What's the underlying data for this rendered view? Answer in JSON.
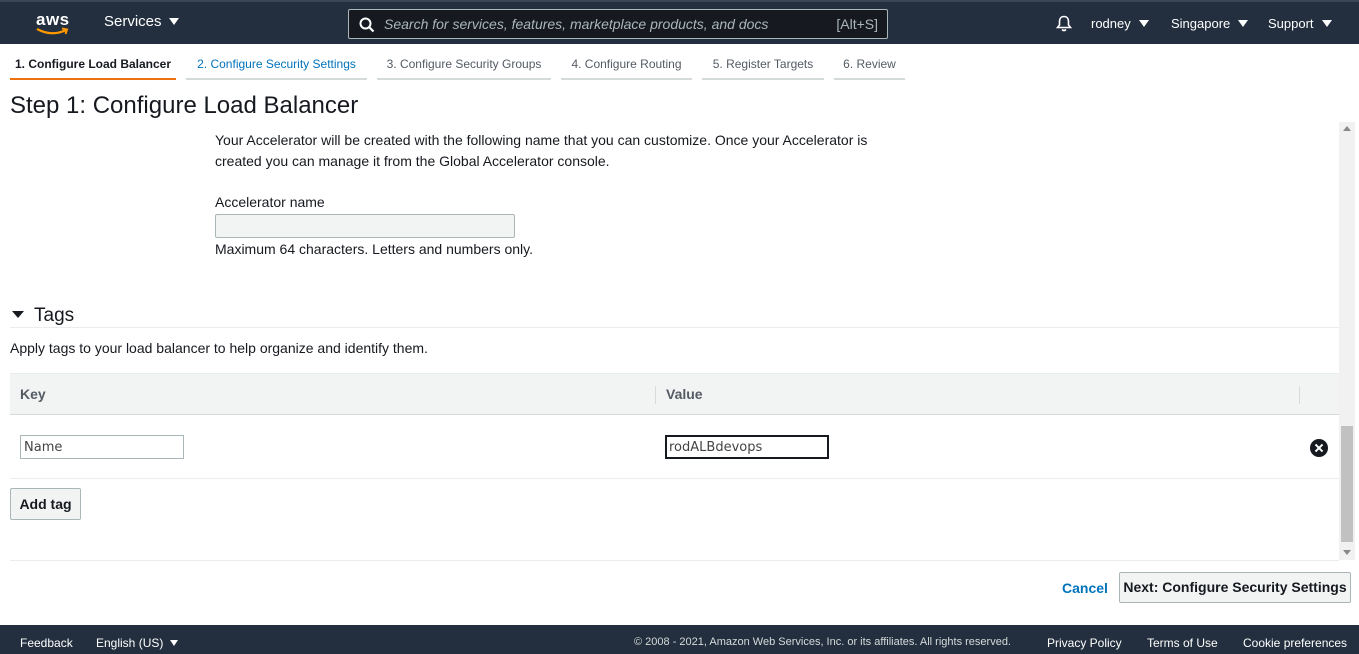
{
  "topnav": {
    "logo_text": "aws",
    "services_label": "Services",
    "search_placeholder": "Search for services, features, marketplace products, and docs",
    "search_shortcut": "[Alt+S]",
    "user": "rodney",
    "region": "Singapore",
    "support": "Support"
  },
  "steps": [
    {
      "label": "1. Configure Load Balancer"
    },
    {
      "label": "2. Configure Security Settings"
    },
    {
      "label": "3. Configure Security Groups"
    },
    {
      "label": "4. Configure Routing"
    },
    {
      "label": "5. Register Targets"
    },
    {
      "label": "6. Review"
    }
  ],
  "page_title": "Step 1: Configure Load Balancer",
  "accelerator": {
    "description": "Your Accelerator will be created with the following name that you can customize. Once your Accelerator is created you can manage it from the Global Accelerator console.",
    "name_label": "Accelerator name",
    "name_value": "",
    "hint": "Maximum 64 characters. Letters and numbers only."
  },
  "tags": {
    "title": "Tags",
    "description": "Apply tags to your load balancer to help organize and identify them.",
    "columns": {
      "key": "Key",
      "value": "Value"
    },
    "rows": [
      {
        "key": "Name",
        "value": "rodALBdevops"
      }
    ],
    "add_label": "Add tag"
  },
  "actions": {
    "cancel": "Cancel",
    "next": "Next: Configure Security Settings"
  },
  "footer": {
    "feedback": "Feedback",
    "language": "English (US)",
    "copyright": "© 2008 - 2021, Amazon Web Services, Inc. or its affiliates. All rights reserved.",
    "privacy": "Privacy Policy",
    "terms": "Terms of Use",
    "cookies": "Cookie preferences"
  },
  "colors": {
    "nav_bg": "#232f3e",
    "accent_orange": "#ec7211",
    "link_blue": "#0073bb"
  }
}
